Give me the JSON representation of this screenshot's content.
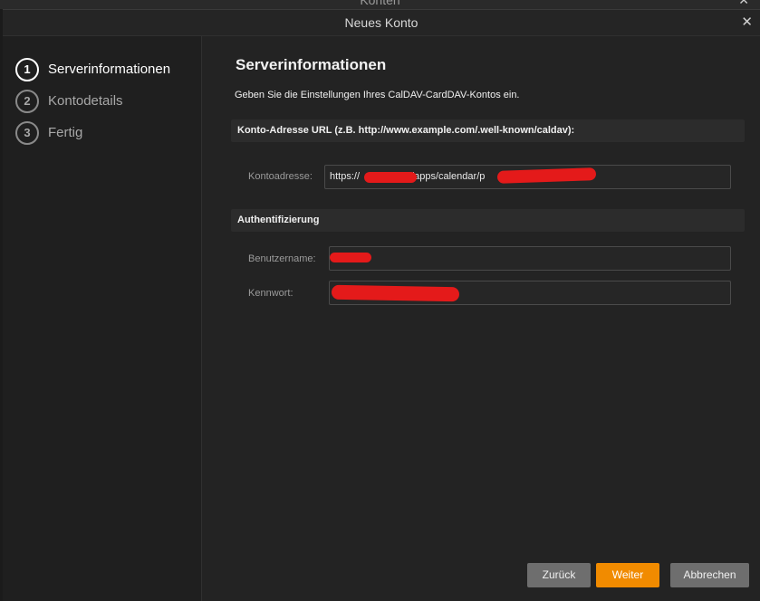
{
  "background_window": {
    "title": "Konten",
    "close_symbol": "✕"
  },
  "dialog": {
    "title": "Neues Konto",
    "close_symbol": "✕"
  },
  "steps": [
    {
      "number": "1",
      "label": "Serverinformationen",
      "active": true
    },
    {
      "number": "2",
      "label": "Kontodetails",
      "active": false
    },
    {
      "number": "3",
      "label": "Fertig",
      "active": false
    }
  ],
  "main": {
    "heading": "Serverinformationen",
    "description": "Geben Sie die Einstellungen Ihres CalDAV-CardDAV-Kontos ein.",
    "url_section": {
      "header": "Konto-Adresse URL (z.B. http://www.example.com/.well-known/caldav):",
      "address_label": "Kontoadresse:",
      "address_prefix": "https://",
      "address_middle": "/apps/calendar/p"
    },
    "auth_section": {
      "header": "Authentifizierung",
      "username_label": "Benutzername:",
      "password_label": "Kennwort:"
    }
  },
  "buttons": {
    "back": "Zurück",
    "next": "Weiter",
    "cancel": "Abbrechen"
  },
  "colors": {
    "accent": "#f18b00",
    "redaction": "#e41a1a"
  }
}
